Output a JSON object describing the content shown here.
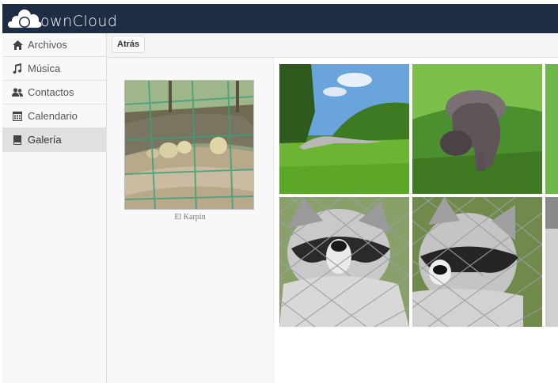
{
  "app": {
    "logo_text": "ownCloud"
  },
  "nav": [
    {
      "label": "Archivos",
      "icon": "home-icon"
    },
    {
      "label": "Música",
      "icon": "music-note-icon"
    },
    {
      "label": "Contactos",
      "icon": "contacts-icon"
    },
    {
      "label": "Calendario",
      "icon": "calendar-icon"
    },
    {
      "label": "Galería",
      "icon": "gallery-icon",
      "active": true
    }
  ],
  "toolbar": {
    "back_label": "Atrás"
  },
  "album": {
    "name": "El Karpin"
  },
  "colors": {
    "topbar": "#1d2d44",
    "sidebar_bg": "#f8f8f8",
    "active_item": "#e0e0e0"
  }
}
